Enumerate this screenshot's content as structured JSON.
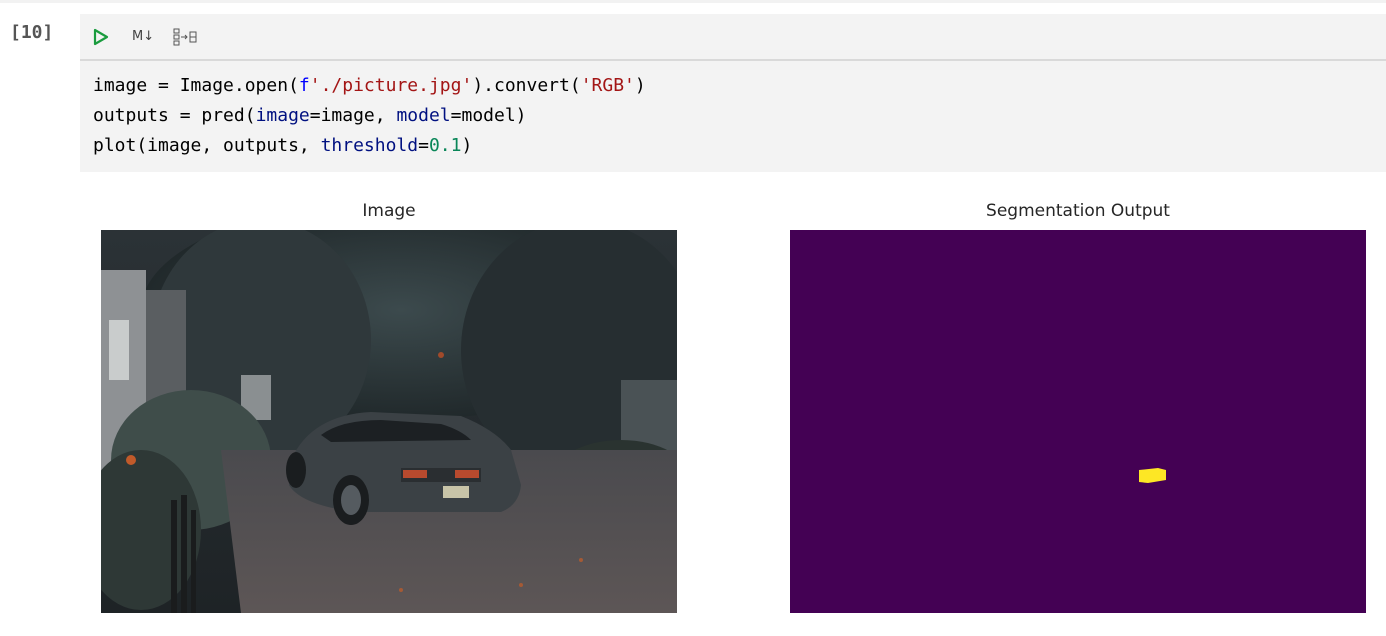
{
  "cell": {
    "execution_count": "[10]",
    "toolbar": {
      "run_icon": "play-icon",
      "markdown_label": "M↓",
      "split_icon": "split-cell-icon"
    },
    "code_lines": [
      "image = Image.open(f'./picture.jpg').convert('RGB')",
      "outputs = pred(image=image, model=model)",
      "plot(image, outputs, threshold=0.1)"
    ]
  },
  "output": {
    "left_panel": {
      "title": "Image",
      "content": "photo of a grey sports car parked on a brick driveway among trees"
    },
    "right_panel": {
      "title": "Segmentation Output",
      "background_color": "#440154",
      "mask_color": "#fde725"
    }
  },
  "colors": {
    "cell_background": "#f3f3f3",
    "run_icon": "#1a9c3e",
    "string": "#a31515",
    "identifier": "#001080",
    "number": "#098658",
    "f_prefix": "#0000ff"
  }
}
